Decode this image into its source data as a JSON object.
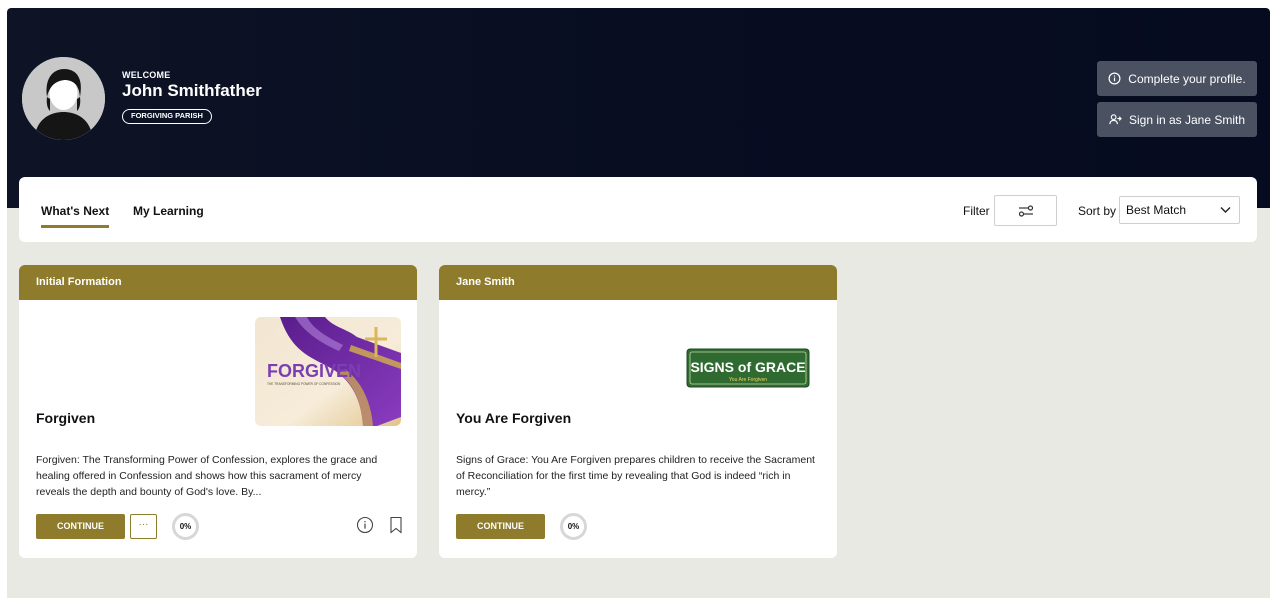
{
  "header": {
    "welcome_label": "WELCOME",
    "user_name": "John Smithfather",
    "parish_badge": "FORGIVING PARISH",
    "complete_profile_label": "Complete your profile.",
    "sign_in_as_label": "Sign in as Jane Smith"
  },
  "tabs": [
    {
      "label": "What's Next",
      "active": true
    },
    {
      "label": "My Learning",
      "active": false
    }
  ],
  "toolbar": {
    "filter_label": "Filter",
    "sort_label": "Sort by",
    "sort_value": "Best Match"
  },
  "cards": [
    {
      "header": "Initial Formation",
      "title": "Forgiven",
      "description": "Forgiven: The Transforming Power of Confession, explores the grace and healing offered in Confession and shows how this sacrament of mercy reveals the depth and bounty of God's love. By...",
      "continue_label": "CONTINUE",
      "more_label": "···",
      "progress": "0%",
      "thumbnail_text": "FORGIVEN",
      "thumbnail_subtitle": "THE TRANSFORMING POWER OF CONFESSION"
    },
    {
      "header": "Jane Smith",
      "title": "You Are Forgiven",
      "description": "Signs of Grace: You Are Forgiven prepares children to receive the Sacrament of Reconciliation for the first time by revealing that God is indeed “rich in mercy.”",
      "continue_label": "CONTINUE",
      "progress": "0%",
      "logo_text": "SIGNS of GRACE",
      "logo_subtitle": "You Are Forgiven"
    }
  ],
  "colors": {
    "accent": "#8e7b2b",
    "hero_bg": "#0a0f24",
    "page_bg": "#e9e9e3",
    "hero_button": "#4a5261",
    "logo_green": "#2f6b30"
  }
}
